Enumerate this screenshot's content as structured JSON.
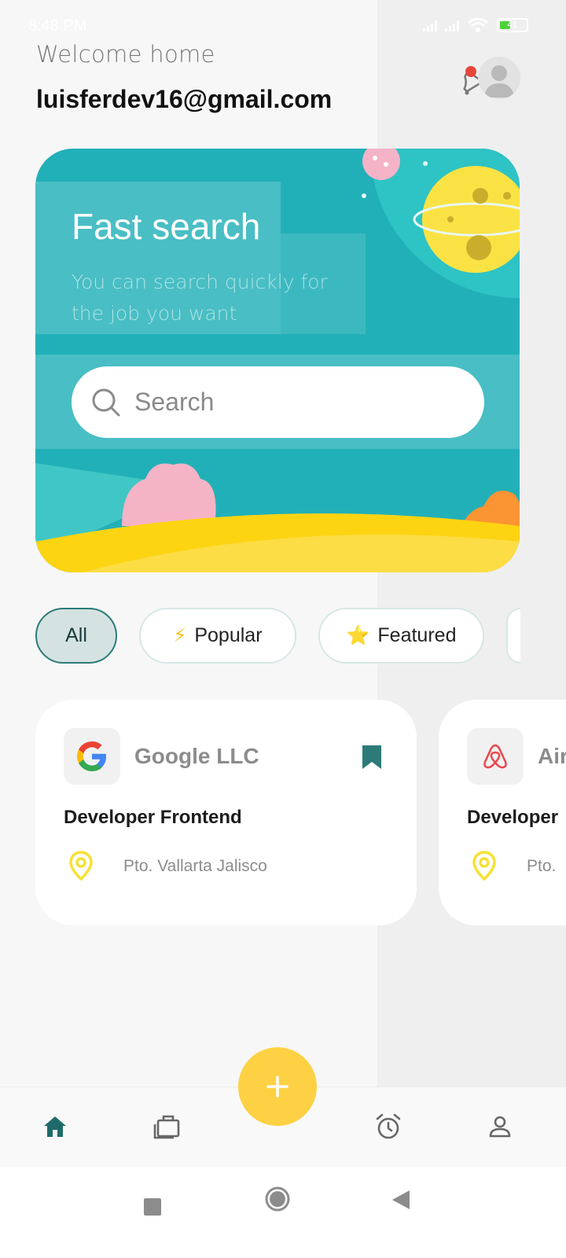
{
  "status_bar": {
    "time": "8:48 PM",
    "battery_level": "41",
    "battery_fraction": 0.41
  },
  "header": {
    "welcome": "Welcome home",
    "email": "luisferdev16@gmail.com"
  },
  "hero": {
    "title": "Fast search",
    "subtitle": "You can search quickly for the job you want",
    "search_placeholder": "Search"
  },
  "filters": [
    {
      "label": "All",
      "icon": "",
      "active": true
    },
    {
      "label": "Popular",
      "icon": "⚡",
      "active": false
    },
    {
      "label": "Featured",
      "icon": "⭐",
      "active": false
    }
  ],
  "jobs": [
    {
      "company": "Google LLC",
      "position": "Developer Frontend",
      "location": "Pto. Vallarta Jalisco",
      "logo": "google-logo",
      "bookmarked": true
    },
    {
      "company": "Airbnb",
      "position": "Developer",
      "location": "Pto.",
      "logo": "airbnb-logo",
      "bookmarked": false
    }
  ],
  "colors": {
    "accent": "#2d7b78",
    "hero": "#22b0b8",
    "fab": "#fdd143",
    "pin": "#f6e135"
  },
  "nav": [
    "home-icon",
    "briefcase-icon",
    "alarm-icon",
    "user-icon"
  ]
}
